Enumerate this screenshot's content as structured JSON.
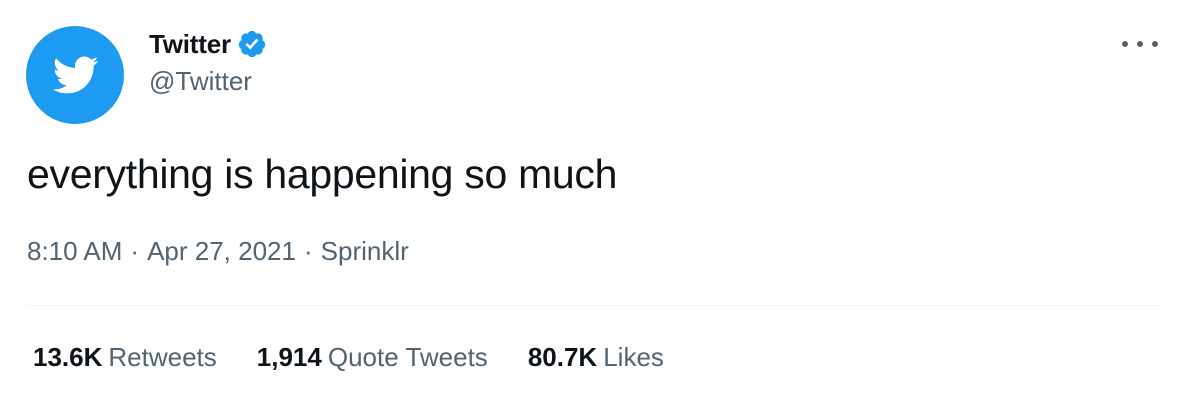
{
  "author": {
    "display_name": "Twitter",
    "handle": "@Twitter",
    "verified": true,
    "avatar_icon": "twitter-bird-icon",
    "avatar_color": "#1d9bf0"
  },
  "tweet": {
    "text": "everything is happening so much",
    "time": "8:10 AM",
    "date": "Apr 27, 2021",
    "source": "Sprinklr",
    "separator": "·"
  },
  "stats": {
    "retweets": {
      "count": "13.6K",
      "label": "Retweets"
    },
    "quote_tweets": {
      "count": "1,914",
      "label": "Quote Tweets"
    },
    "likes": {
      "count": "80.7K",
      "label": "Likes"
    }
  },
  "colors": {
    "text_primary": "#0f1419",
    "text_secondary": "#536471",
    "accent": "#1d9bf0",
    "divider": "#eff3f4"
  }
}
